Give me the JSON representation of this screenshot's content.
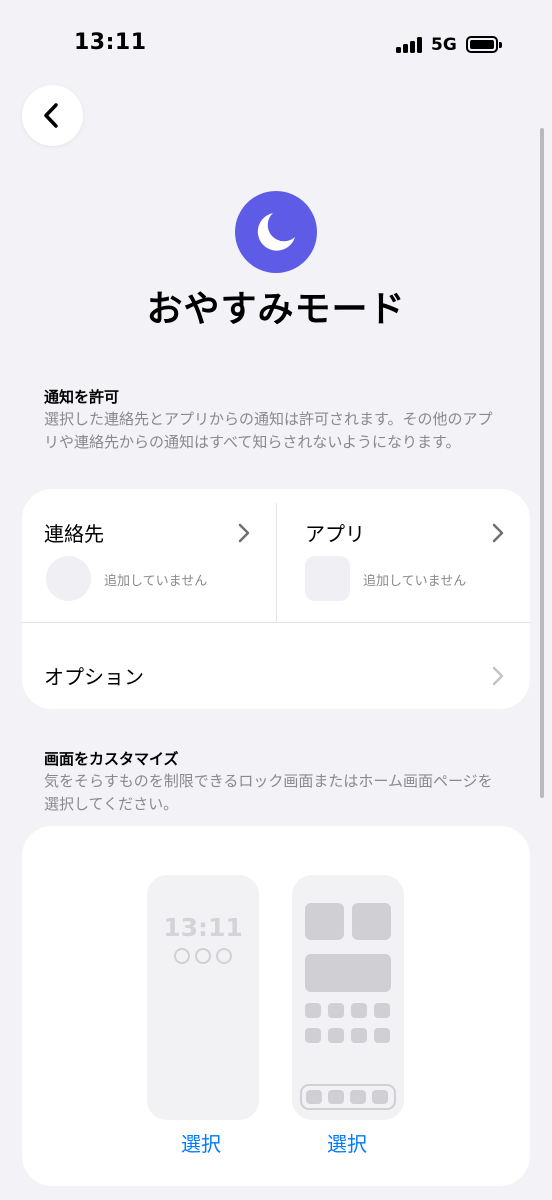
{
  "status_bar": {
    "time": "13:11",
    "network": "5G"
  },
  "header": {
    "title": "おやすみモード"
  },
  "allow_notifications": {
    "heading": "通知を許可",
    "description": "選択した連絡先とアプリからの通知は許可されます。その他のアプリや連絡先からの通知はすべて知らされないようになります。",
    "contacts": {
      "label": "連絡先",
      "empty_text": "追加していません"
    },
    "apps": {
      "label": "アプリ",
      "empty_text": "追加していません"
    },
    "options_label": "オプション"
  },
  "customize_screens": {
    "heading": "画面をカスタマイズ",
    "description": "気をそらすものを制限できるロック画面またはホーム画面ページを選択してください。",
    "lock_screen": {
      "time": "13:11",
      "select_label": "選択"
    },
    "home_screen": {
      "select_label": "選択"
    }
  },
  "colors": {
    "focus_accent": "#5e5ce6",
    "link": "#007aff",
    "background": "#f2f2f7"
  },
  "icons": {
    "back": "chevron-left-icon",
    "mode": "moon-icon",
    "disclosure": "chevron-right-icon"
  }
}
